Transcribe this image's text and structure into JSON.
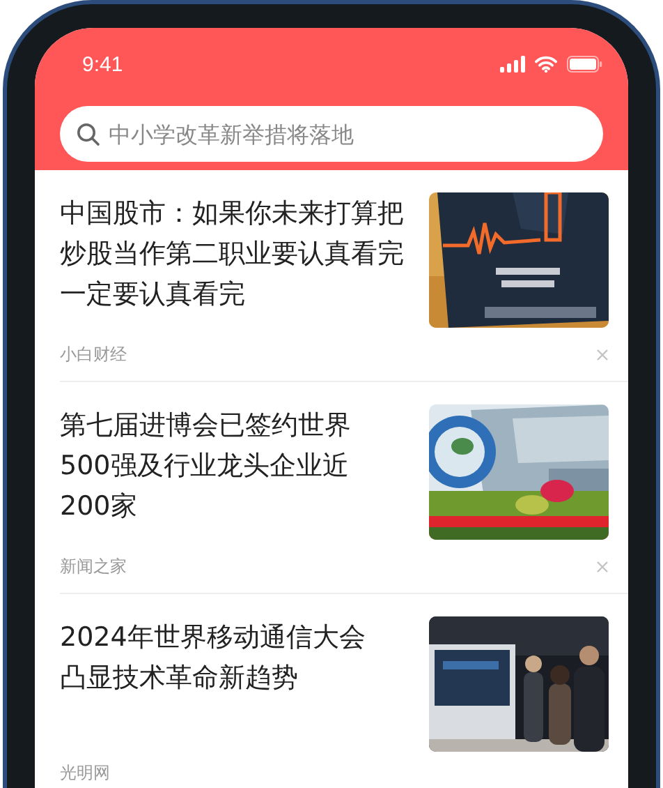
{
  "status_bar": {
    "time": "9:41"
  },
  "search": {
    "placeholder": "中小学改革新举措将落地"
  },
  "articles": [
    {
      "title_lines": [
        "中国股市：如果你未来打算把",
        "炒股当作第二职业要认真看完",
        "一定要认真看完"
      ],
      "source": "小白财经"
    },
    {
      "title_lines": [
        "第七届进博会已签约世界",
        "500强及行业龙头企业近",
        "200家"
      ],
      "source": "新闻之家"
    },
    {
      "title_lines": [
        "2024年世界移动通信大会",
        "凸显技术革命新趋势"
      ],
      "source": "光明网"
    }
  ]
}
